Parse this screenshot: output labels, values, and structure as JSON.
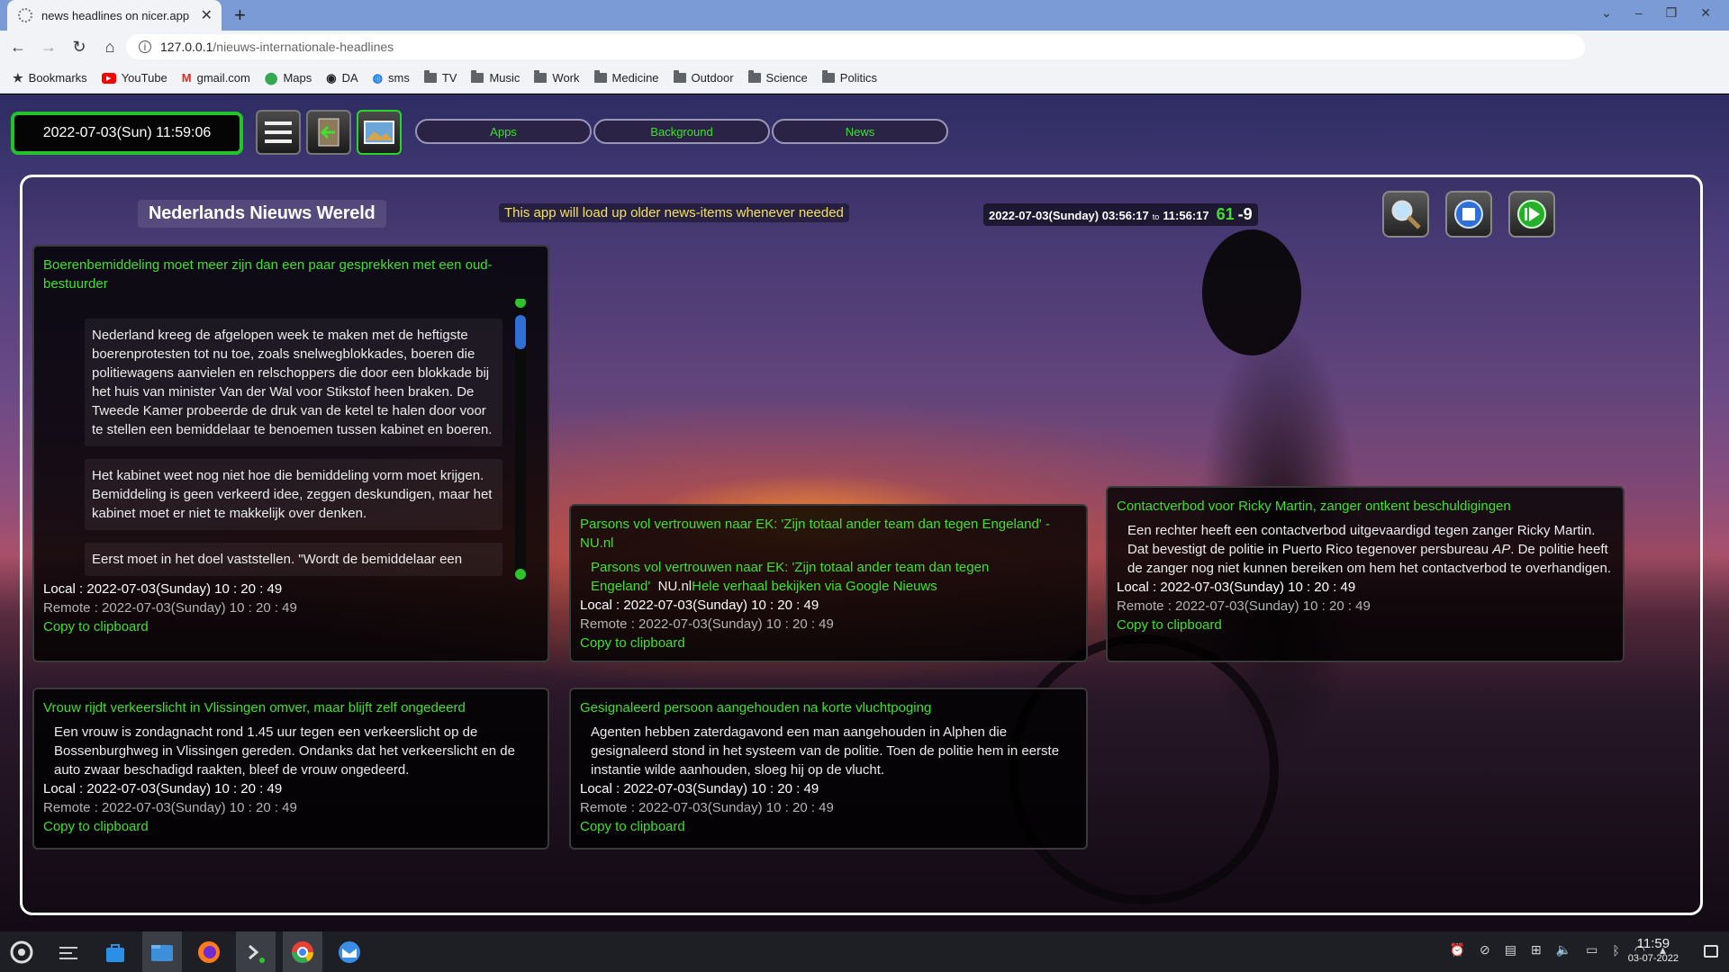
{
  "browser": {
    "tab_title": "news headlines on nicer.app",
    "tab_close": "✕",
    "new_tab": "+",
    "url_host": "127.0.0.1",
    "url_path": "/nieuws-internationale-headlines",
    "bookmarks": [
      {
        "label": "Bookmarks",
        "icon": "star-icon"
      },
      {
        "label": "YouTube",
        "icon": "youtube-icon"
      },
      {
        "label": "gmail.com",
        "icon": "gmail-icon"
      },
      {
        "label": "Maps",
        "icon": "maps-icon"
      },
      {
        "label": "DA",
        "icon": "github-icon"
      },
      {
        "label": "sms",
        "icon": "sms-icon"
      },
      {
        "label": "TV",
        "icon": "folder-icon"
      },
      {
        "label": "Music",
        "icon": "folder-icon"
      },
      {
        "label": "Work",
        "icon": "folder-icon"
      },
      {
        "label": "Medicine",
        "icon": "folder-icon"
      },
      {
        "label": "Outdoor",
        "icon": "folder-icon"
      },
      {
        "label": "Science",
        "icon": "folder-icon"
      },
      {
        "label": "Politics",
        "icon": "folder-icon"
      }
    ]
  },
  "header": {
    "datetime": "2022-07-03(Sun) 11:59:06",
    "menu_buttons": [
      "Apps",
      "Background",
      "News"
    ]
  },
  "app": {
    "title": "Nederlands Nieuws Wereld",
    "note": "This app will load up older news-items whenever needed",
    "range_from": "2022-07-03(Sunday) 03:56:17",
    "range_to_word": "to",
    "range_to": "11:56:17",
    "count": "61",
    "delta": "-9"
  },
  "cards": {
    "c1": {
      "title": "Boerenbemiddeling moet meer zijn dan een paar gesprekken met een oud-bestuurder",
      "paragraphs": [
        "Nederland kreeg de afgelopen week te maken met de heftigste boerenprotesten tot nu toe, zoals snelwegblokkades, boeren die politiewagens aanvielen en relschoppers die door een blokkade bij het huis van minister Van der Wal voor Stikstof heen braken. De Tweede Kamer probeerde de druk van de ketel te halen door voor te stellen een bemiddelaar te benoemen tussen kabinet en boeren.",
        "Het kabinet weet nog niet hoe die bemiddeling vorm moet krijgen. Bemiddeling is geen verkeerd idee, zeggen deskundigen, maar het kabinet moet er niet te makkelijk over denken.",
        "Eerst moet in het doel vaststellen. \"Wordt de bemiddelaar een"
      ],
      "local": "Local : 2022-07-03(Sunday) 10 : 20 : 49",
      "remote": "Remote : 2022-07-03(Sunday) 10 : 20 : 49",
      "copy": "Copy to clipboard"
    },
    "c2": {
      "title": "Parsons vol vertrouwen naar EK: 'Zijn totaal ander team dan tegen Engeland' - NU.nl",
      "body_link": "Parsons vol vertrouwen naar EK: 'Zijn totaal ander team dan tegen Engeland'",
      "body_source": "NU.nl",
      "body_more": "Hele verhaal bekijken via Google Nieuws",
      "local": "Local : 2022-07-03(Sunday) 10 : 20 : 49",
      "remote": "Remote : 2022-07-03(Sunday) 10 : 20 : 49",
      "copy": "Copy to clipboard"
    },
    "c3": {
      "title": "Contactverbod voor Ricky Martin, zanger ontkent beschuldigingen",
      "body_a": "Een rechter heeft een contactverbod uitgevaardigd tegen zanger Ricky Martin. Dat bevestigt de politie in Puerto Rico tegenover persbureau ",
      "body_em": "AP",
      "body_b": ". De politie heeft de zanger nog niet kunnen bereiken om hem het contactverbod te overhandigen.",
      "local": "Local : 2022-07-03(Sunday) 10 : 20 : 49",
      "remote": "Remote : 2022-07-03(Sunday) 10 : 20 : 49",
      "copy": "Copy to clipboard"
    },
    "c4": {
      "title": "Vrouw rijdt verkeerslicht in Vlissingen omver, maar blijft zelf ongedeerd",
      "body": "Een vrouw is zondagnacht rond 1.45 uur tegen een verkeerslicht op de Bossenburghweg in Vlissingen gereden. Ondanks dat het verkeerslicht en de auto zwaar beschadigd raakten, bleef de vrouw ongedeerd.",
      "local": "Local : 2022-07-03(Sunday) 10 : 20 : 49",
      "remote": "Remote : 2022-07-03(Sunday) 10 : 20 : 49",
      "copy": "Copy to clipboard"
    },
    "c5": {
      "title": "Gesignaleerd persoon aangehouden na korte vluchtpoging",
      "body": "Agenten hebben zaterdagavond een man aangehouden in Alphen die gesignaleerd stond in het systeem van de politie. Toen de politie hem in eerste instantie wilde aanhouden, sloeg hij op de vlucht.",
      "local": "Local : 2022-07-03(Sunday) 10 : 20 : 49",
      "remote": "Remote : 2022-07-03(Sunday) 10 : 20 : 49",
      "copy": "Copy to clipboard"
    }
  },
  "taskbar": {
    "time": "11:59",
    "date": "03-07-2022"
  },
  "colors": {
    "accent_green": "#3ee12b",
    "note_yellow": "#f3e35a",
    "scroll_thumb": "#2f6fd6"
  }
}
